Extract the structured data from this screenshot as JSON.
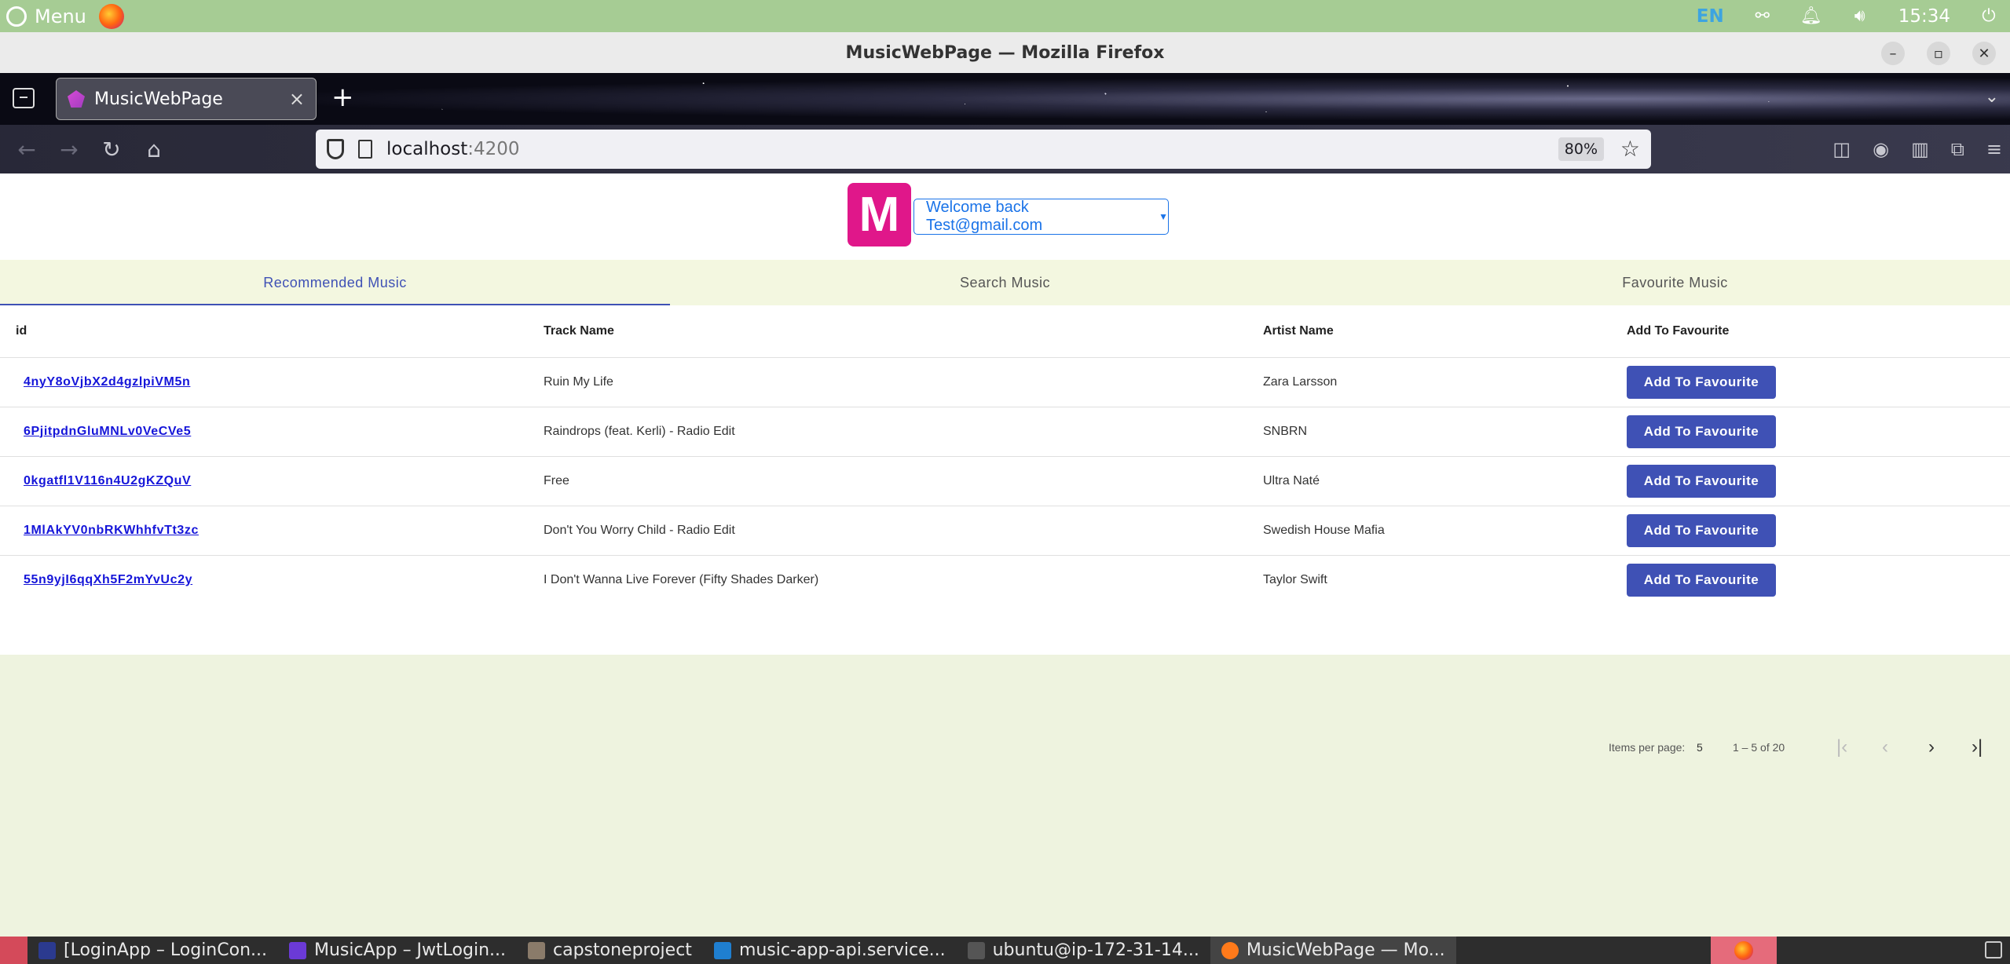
{
  "system_panel": {
    "menu_label": "Menu",
    "language": "EN",
    "clock": "15:34"
  },
  "window": {
    "title": "MusicWebPage — Mozilla Firefox"
  },
  "browser": {
    "tab_title": "MusicWebPage",
    "url_host": "localhost",
    "url_port": ":4200",
    "zoom": "80%"
  },
  "app": {
    "logo_letter": "M",
    "welcome": "Welcome back Test@gmail.com",
    "tabs": [
      {
        "label": "Recommended Music",
        "active": true
      },
      {
        "label": "Search Music",
        "active": false
      },
      {
        "label": "Favourite Music",
        "active": false
      }
    ],
    "table": {
      "headers": [
        "id",
        "Track Name",
        "Artist Name",
        "Add To Favourite"
      ],
      "rows": [
        {
          "id": "4nyY8oVjbX2d4gzlpiVM5n",
          "track": "Ruin My Life",
          "artist": "Zara Larsson",
          "action": "Add To Favourite"
        },
        {
          "id": "6PjitpdnGluMNLv0VeCVe5",
          "track": "Raindrops (feat. Kerli) - Radio Edit",
          "artist": "SNBRN",
          "action": "Add To Favourite"
        },
        {
          "id": "0kgatfl1V116n4U2gKZQuV",
          "track": "Free",
          "artist": "Ultra Naté",
          "action": "Add To Favourite"
        },
        {
          "id": "1MlAkYV0nbRKWhhfvTt3zc",
          "track": "Don't You Worry Child - Radio Edit",
          "artist": "Swedish House Mafia",
          "action": "Add To Favourite"
        },
        {
          "id": "55n9yjI6qqXh5F2mYvUc2y",
          "track": "I Don't Wanna Live Forever (Fifty Shades Darker)",
          "artist": "Taylor Swift",
          "action": "Add To Favourite"
        }
      ]
    },
    "paginator": {
      "label": "Items per page:",
      "page_size": "5",
      "range": "1 – 5 of 20"
    }
  },
  "taskbar": {
    "items": [
      "[LoginApp – LoginCon...",
      "MusicApp – JwtLogin...",
      "capstoneproject",
      "music-app-api.service...",
      "ubuntu@ip-172-31-14...",
      "MusicWebPage — Mo..."
    ]
  },
  "colors": {
    "accent": "#3f51b5",
    "logo": "#e0178a",
    "link": "#1515d9",
    "panel": "#a6cc94",
    "page_bg": "#eef3df"
  }
}
